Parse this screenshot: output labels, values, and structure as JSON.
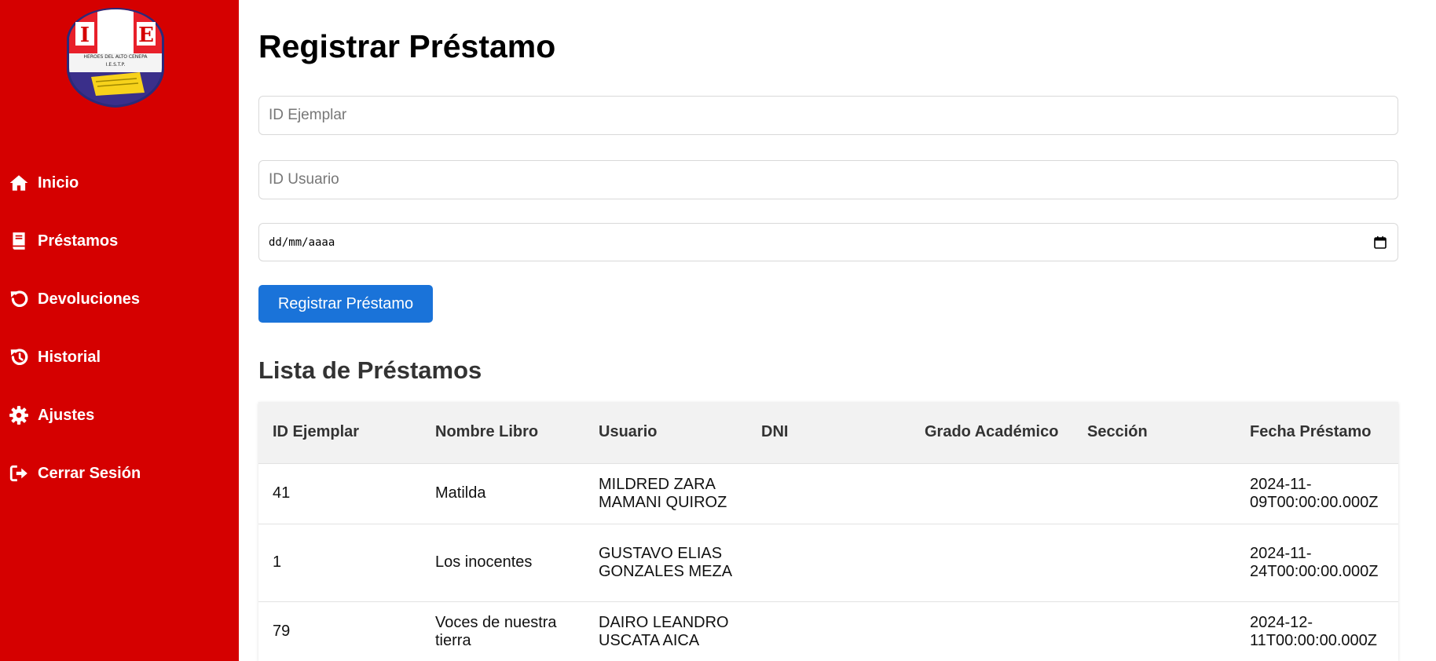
{
  "sidebar": {
    "logo": {
      "letters": [
        "I",
        "E"
      ],
      "ring_text": "HEROES DEL ALTO CENEPA",
      "caption": "I.E.S.T.P."
    },
    "items": [
      {
        "label": "Inicio",
        "icon": "home-icon"
      },
      {
        "label": "Préstamos",
        "icon": "book-icon"
      },
      {
        "label": "Devoluciones",
        "icon": "undo-icon"
      },
      {
        "label": "Historial",
        "icon": "history-icon"
      },
      {
        "label": "Ajustes",
        "icon": "gear-icon"
      },
      {
        "label": "Cerrar Sesión",
        "icon": "logout-icon"
      }
    ]
  },
  "form": {
    "title": "Registrar Préstamo",
    "id_ejemplar_placeholder": "ID Ejemplar",
    "id_usuario_placeholder": "ID Usuario",
    "date_placeholder": "dd/mm/aaaa",
    "submit_label": "Registrar Préstamo"
  },
  "list": {
    "title": "Lista de Préstamos",
    "columns": [
      "ID Ejemplar",
      "Nombre Libro",
      "Usuario",
      "DNI",
      "Grado Académico",
      "Sección",
      "Fecha Préstamo"
    ],
    "rows": [
      {
        "id_ejemplar": "41",
        "nombre_libro": "Matilda",
        "usuario": "MILDRED ZARA MAMANI QUIROZ",
        "dni": "",
        "grado": "",
        "seccion": "",
        "fecha": "2024-11-09T00:00:00.000Z"
      },
      {
        "id_ejemplar": "1",
        "nombre_libro": "Los inocentes",
        "usuario": "GUSTAVO ELIAS GONZALES MEZA",
        "dni": "",
        "grado": "",
        "seccion": "",
        "fecha": "2024-11-24T00:00:00.000Z"
      },
      {
        "id_ejemplar": "79",
        "nombre_libro": "Voces de nuestra tierra",
        "usuario": "DAIRO LEANDRO USCATA AICA",
        "dni": "",
        "grado": "",
        "seccion": "",
        "fecha": "2024-12-11T00:00:00.000Z"
      }
    ]
  },
  "colors": {
    "sidebar_bg": "#d50000",
    "primary_button": "#1a73d9",
    "table_header_bg": "#f2f2f2"
  }
}
